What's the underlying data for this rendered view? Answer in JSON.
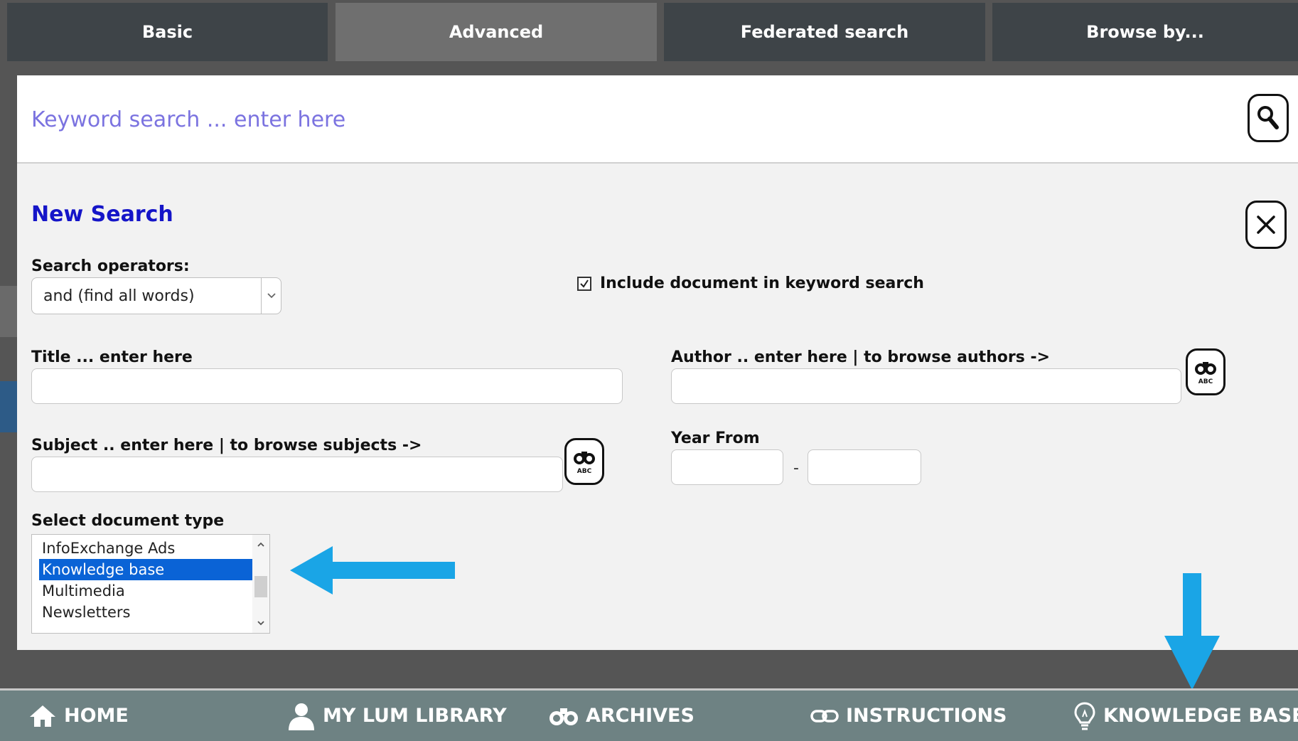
{
  "tabs": {
    "basic": "Basic",
    "advanced": "Advanced",
    "federated": "Federated search",
    "browse": "Browse by..."
  },
  "keyword": {
    "placeholder": "Keyword search ... enter here"
  },
  "form": {
    "heading": "New Search",
    "operators_label": "Search operators:",
    "operators_value": "and (find all words)",
    "include_doc_label": "Include document in keyword search",
    "include_doc_checked": true,
    "title_label": "Title ... enter here",
    "author_label": "Author .. enter here | to browse authors ->",
    "subject_label": "Subject .. enter here | to browse subjects ->",
    "year_label": "Year From",
    "year_separator": "-",
    "doctype_label": "Select document type",
    "doctypes": [
      "InfoExchange Ads",
      "Knowledge base",
      "Multimedia",
      "Newsletters"
    ],
    "doctype_selected": "Knowledge base"
  },
  "icons": {
    "search": "search-icon",
    "close": "close-icon",
    "binoculars": "binoculars-abc-icon",
    "checkbox": "checkmark-icon",
    "home": "home-icon",
    "user": "user-icon",
    "archives": "binoculars-icon",
    "instructions": "link-icon",
    "knowledge": "lightbulb-icon"
  },
  "bottom_nav": {
    "home": "HOME",
    "library": "MY LUM LIBRARY",
    "archives": "ARCHIVES",
    "instructions": "INSTRUCTIONS",
    "knowledge": "KNOWLEDGE BASE"
  },
  "colors": {
    "accent_blue": "#1515c8",
    "selection": "#0a63d6",
    "annotation_arrow": "#1aa5e6",
    "nav_bg": "#6e8283"
  }
}
